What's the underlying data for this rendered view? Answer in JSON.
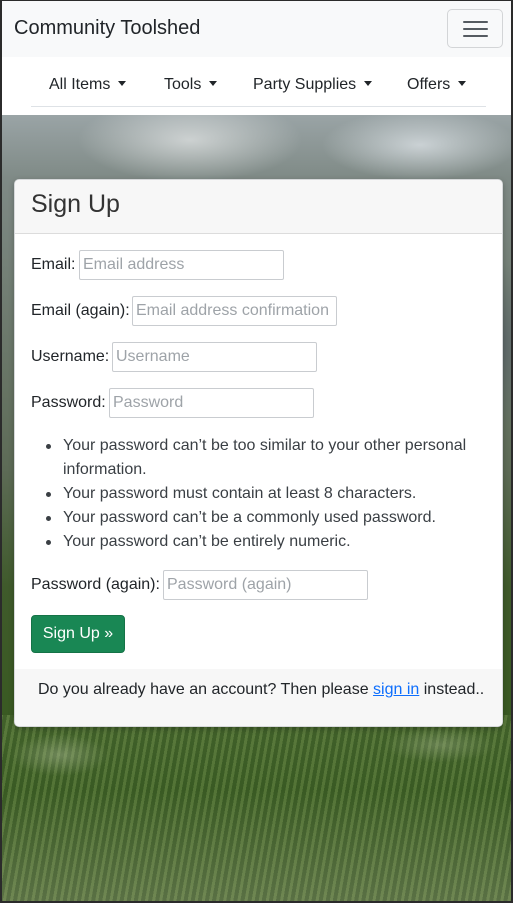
{
  "navbar": {
    "brand": "Community Toolshed",
    "toggler_icon": "hamburger-menu-icon"
  },
  "subnav": {
    "items": [
      {
        "label": "All Items"
      },
      {
        "label": "Tools"
      },
      {
        "label": "Party Supplies"
      },
      {
        "label": "Offers"
      }
    ]
  },
  "form": {
    "title": "Sign Up",
    "email": {
      "label": "Email:",
      "placeholder": "Email address",
      "value": ""
    },
    "email2": {
      "label": "Email (again):",
      "placeholder": "Email address confirmation",
      "value": ""
    },
    "username": {
      "label": "Username:",
      "placeholder": "Username",
      "value": ""
    },
    "password": {
      "label": "Password:",
      "placeholder": "Password",
      "value": ""
    },
    "password_help": [
      "Your password can’t be too similar to your other personal information.",
      "Your password must contain at least 8 characters.",
      "Your password can’t be a commonly used password.",
      "Your password can’t be entirely numeric."
    ],
    "password2": {
      "label": "Password (again):",
      "placeholder": "Password (again)",
      "value": ""
    },
    "submit_label": "Sign Up »"
  },
  "footer": {
    "text_before": "Do you already have an account? Then please ",
    "link_label": "sign in",
    "text_after": " instead.."
  },
  "colors": {
    "primary_button": "#198754",
    "link": "#0d6efd",
    "navbar_bg": "#f8f9fa"
  }
}
